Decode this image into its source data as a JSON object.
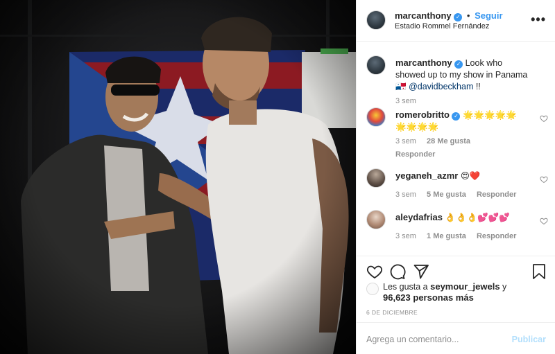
{
  "photo": {
    "alt_icon": "photo-of-two-men-in-front-of-flag"
  },
  "header": {
    "username": "marcanthony",
    "separator": "•",
    "follow_label": "Seguir",
    "location": "Estadio Rommel Fernández",
    "more_icon": "ellipsis-icon",
    "more_label": "•••"
  },
  "caption": {
    "username": "marcanthony",
    "text": "Look who showed up to my show in Panama",
    "flag": "🇵🇦",
    "mention": "@davidbeckham",
    "suffix": " !!",
    "time": "3 sem"
  },
  "comments": [
    {
      "username": "romerobritto",
      "text": "🌟🌟🌟🌟🌟🌟🌟🌟🌟",
      "time": "3 sem",
      "likes": "28 Me gusta",
      "reply": "Responder"
    },
    {
      "username": "yeganeh_azmr",
      "text": "😍❤️",
      "time": "3 sem",
      "likes": "5 Me gusta",
      "reply": "Responder"
    },
    {
      "username": "aleydafrias",
      "text": "👌👌👌💕💕💕",
      "time": "3 sem",
      "likes": "1 Me gusta",
      "reply": "Responder"
    }
  ],
  "actions": {
    "like_icon": "heart-outline-icon",
    "comment_icon": "comment-icon",
    "share_icon": "paper-plane-icon",
    "save_icon": "bookmark-icon"
  },
  "likes": {
    "prefix": "Les gusta a ",
    "user": "seymour_jewels",
    "middle": " y",
    "count": "96,623 personas más"
  },
  "date": "6 DE DICIEMBRE",
  "add_comment": {
    "placeholder": "Agrega un comentario...",
    "post_label": "Publicar"
  },
  "colors": {
    "accent": "#3897f0",
    "post_disabled": "#b2dffc"
  }
}
